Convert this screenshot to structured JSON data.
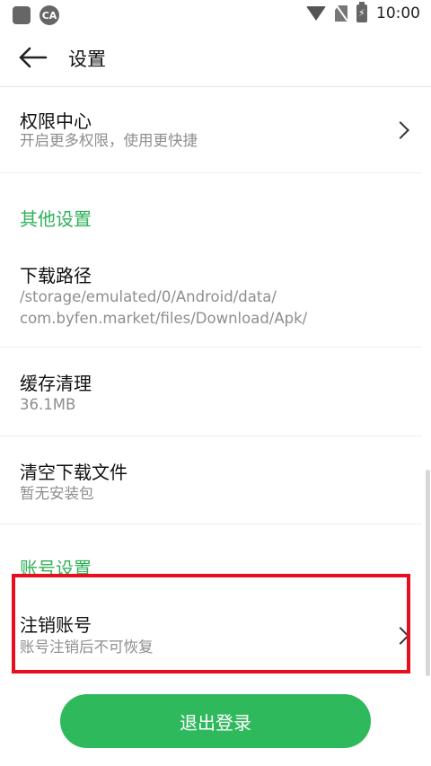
{
  "status_bar": {
    "time": "10:00",
    "icons": [
      "app-square-icon",
      "ca-circle-icon",
      "wifi-icon",
      "no-sim-icon",
      "battery-charging-icon"
    ],
    "ca_label": "CA"
  },
  "toolbar": {
    "title": "设置",
    "back_icon": "back-arrow-icon"
  },
  "items": {
    "permissions": {
      "title": "权限中心",
      "subtitle": "开启更多权限，使用更快捷"
    },
    "download_path": {
      "title": "下载路径",
      "subtitle_line1": "/storage/emulated/0/Android/data/",
      "subtitle_line2": "com.byfen.market/files/Download/Apk/"
    },
    "cache": {
      "title": "缓存清理",
      "subtitle": "36.1MB"
    },
    "clear_downloads": {
      "title": "清空下载文件",
      "subtitle": "暂无安装包"
    },
    "cancel_account": {
      "title": "注销账号",
      "subtitle": "账号注销后不可恢复"
    }
  },
  "sections": {
    "other": "其他设置",
    "account": "账号设置"
  },
  "logout_button": "退出登录",
  "colors": {
    "accent_green": "#2fb158",
    "button_green": "#2fb95d",
    "highlight_red": "#e60f1e"
  }
}
